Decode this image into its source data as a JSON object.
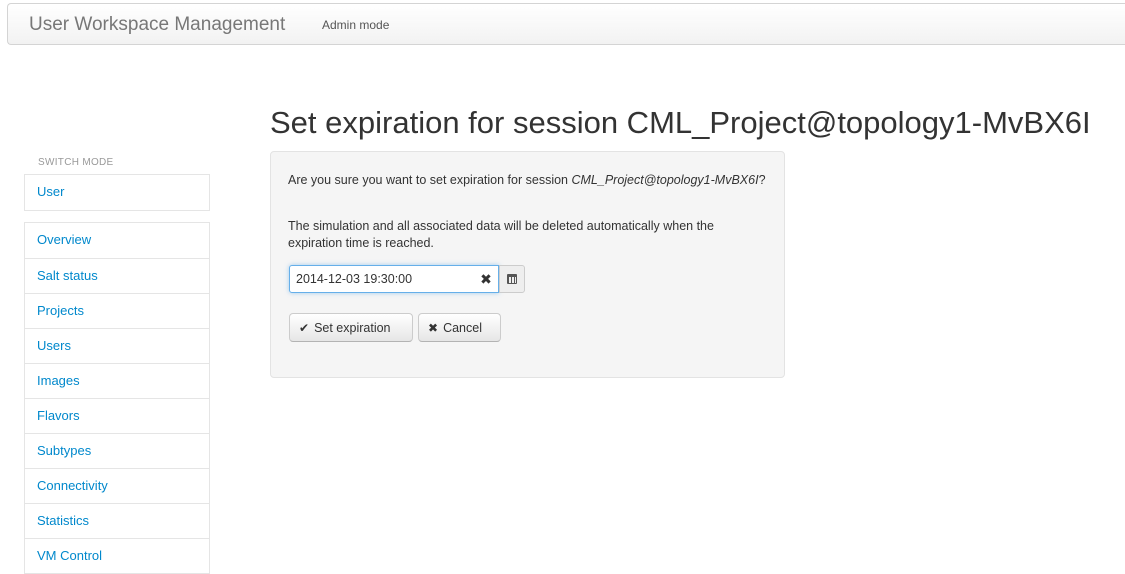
{
  "navbar": {
    "brand": "User Workspace Management",
    "mode_link": "Admin mode"
  },
  "page": {
    "title": "Set expiration for session CML_Project@topology1-MvBX6I"
  },
  "sidebar": {
    "header": "SWITCH MODE",
    "mode_items": [
      {
        "label": "User"
      }
    ],
    "items": [
      {
        "label": "Overview"
      },
      {
        "label": "Salt status"
      },
      {
        "label": "Projects"
      },
      {
        "label": "Users"
      },
      {
        "label": "Images"
      },
      {
        "label": "Flavors"
      },
      {
        "label": "Subtypes"
      },
      {
        "label": "Connectivity"
      },
      {
        "label": "Statistics"
      },
      {
        "label": "VM Control"
      }
    ]
  },
  "dialog": {
    "question_prefix": "Are you sure you want to set expiration for session ",
    "session_name": "CML_Project@topology1-MvBX6I",
    "question_suffix": "?",
    "warning": "The simulation and all associated data will be deleted automatically when the expiration time is reached.",
    "datetime_value": "2014-12-03 19:30:00",
    "clear_icon": "times-icon",
    "calendar_icon": "calendar-icon",
    "set_button_icon": "check-icon",
    "set_button_label": "Set expiration",
    "cancel_button_icon": "times-icon",
    "cancel_button_label": "Cancel"
  },
  "colors": {
    "link": "#0088cc",
    "focus": "#66afe9"
  }
}
